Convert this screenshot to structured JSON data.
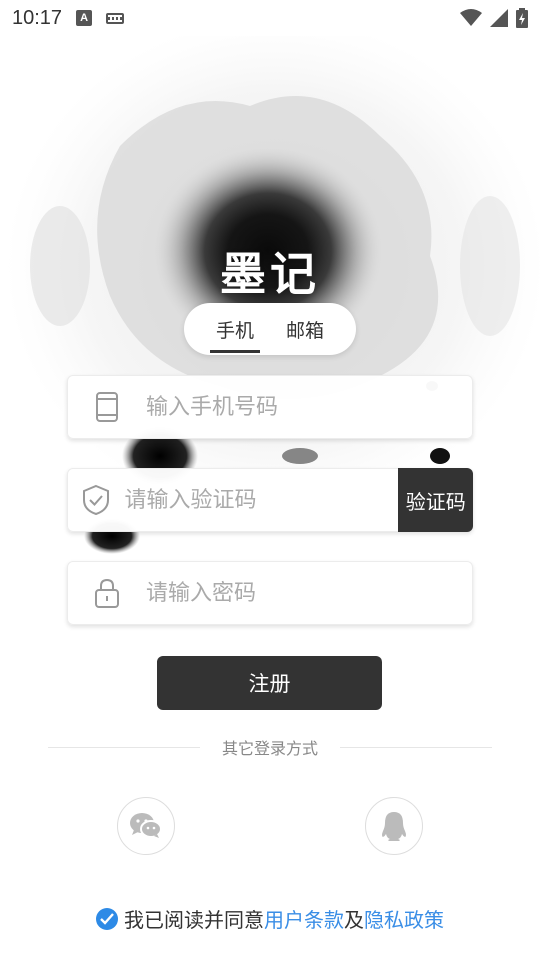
{
  "status_bar": {
    "time": "10:17",
    "icons": [
      "text-a-icon",
      "keyboard-icon",
      "wifi-icon",
      "cellular-signal-icon",
      "battery-charging-icon"
    ]
  },
  "app": {
    "title": "墨记"
  },
  "tabs": [
    {
      "label": "手机",
      "active": true
    },
    {
      "label": "邮箱",
      "active": false
    }
  ],
  "form": {
    "phone_placeholder": "输入手机号码",
    "code_placeholder": "请输入验证码",
    "code_button": "验证码",
    "password_placeholder": "请输入密码"
  },
  "register_button": "注册",
  "other_login": {
    "label": "其它登录方式",
    "providers": [
      "wechat-icon",
      "qq-icon"
    ]
  },
  "agreement": {
    "prefix": "我已阅读并同意",
    "user_terms": "用户条款",
    "and": "及",
    "privacy": "隐私政策",
    "checked": true
  },
  "colors": {
    "primary_dark": "#333333",
    "link_blue": "#3a8ee6",
    "check_blue": "#2d8ae6"
  }
}
